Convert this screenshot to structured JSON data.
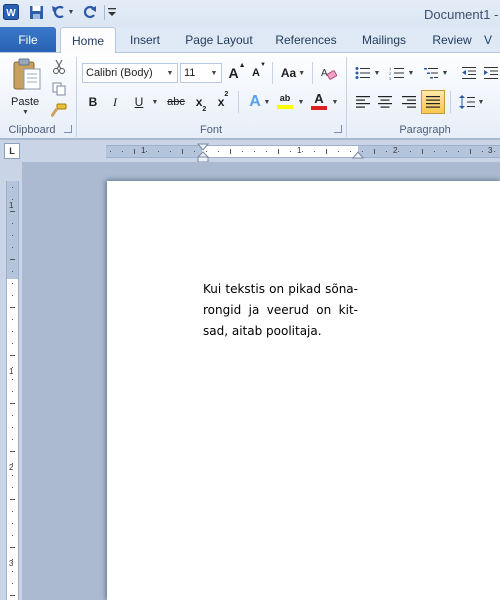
{
  "app": {
    "title": "Document1 -"
  },
  "quick_access": {
    "icons": [
      "word-app-icon",
      "save-icon",
      "undo-icon",
      "redo-icon",
      "customize-icon"
    ]
  },
  "tabs": [
    {
      "label": "File"
    },
    {
      "label": "Home",
      "active": true
    },
    {
      "label": "Insert"
    },
    {
      "label": "Page Layout"
    },
    {
      "label": "References"
    },
    {
      "label": "Mailings"
    },
    {
      "label": "Review"
    },
    {
      "label": "V"
    }
  ],
  "ribbon": {
    "clipboard": {
      "label": "Clipboard",
      "paste_label": "Paste"
    },
    "font": {
      "label": "Font",
      "font_name": "Calibri (Body)",
      "font_size": "11",
      "grow_label": "A",
      "shrink_label": "A",
      "case_label": "Aa",
      "bold_label": "B",
      "italic_label": "I",
      "underline_label": "U",
      "strike_label": "abc",
      "subscript_label": "x",
      "subscript_sub": "2",
      "superscript_label": "x",
      "superscript_sup": "2",
      "effects_label": "A",
      "highlight_label": "ab",
      "color_label": "A",
      "highlight_color": "#ffff00",
      "font_color": "#e02020"
    },
    "paragraph": {
      "label": "Paragraph"
    }
  },
  "ruler": {
    "corner_label": "L",
    "h_numbers": [
      "1",
      "1",
      "2",
      "3"
    ],
    "v_numbers": [
      "1",
      "1",
      "2",
      "3"
    ]
  },
  "document": {
    "lines": [
      "Kui tekstis on pikad sõna-",
      "rongid ja veerud on kit-",
      "sad, aitab poolitaja."
    ]
  },
  "colors": {
    "file_tab": "#2a62b5",
    "ribbon_bg": "#e7eef8",
    "workspace": "#abbad0"
  }
}
